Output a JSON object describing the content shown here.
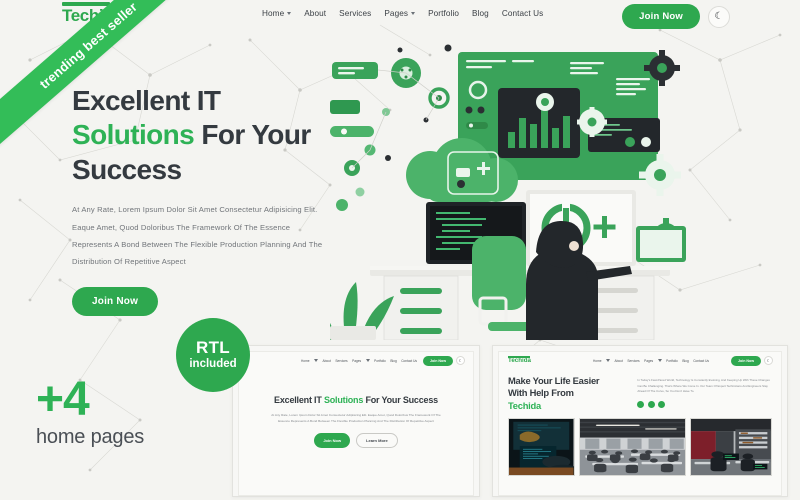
{
  "brand": {
    "name": "Techida",
    "accent_color": "#2ea84f",
    "ribbon_color": "#33bd58",
    "bg_color": "#f4f4f1"
  },
  "ribbon": {
    "text": "trending best seller"
  },
  "navbar": {
    "logo": "Techida",
    "links": [
      {
        "label": "Home",
        "has_dropdown": true
      },
      {
        "label": "About",
        "has_dropdown": false
      },
      {
        "label": "Services",
        "has_dropdown": false
      },
      {
        "label": "Pages",
        "has_dropdown": true
      },
      {
        "label": "Portfolio",
        "has_dropdown": false
      },
      {
        "label": "Blog",
        "has_dropdown": false
      },
      {
        "label": "Contact Us",
        "has_dropdown": false
      }
    ],
    "join_label": "Join Now",
    "theme_toggle_icon": "moon-icon",
    "theme_toggle_glyph": "☾"
  },
  "hero": {
    "title_line1": "Excellent IT",
    "title_accent": "Solutions",
    "title_line2_rest": " For Your",
    "title_line3": "Success",
    "paragraph": "At Any Rate, Lorem Ipsum Dolor Sit Amet Consectetur Adipisicing Elit. Eaque Amet, Quod Doloribus The Framework Of The Essence Represents A Bond Between The Flexible Production Planning And The Distribution Of Repetitive Aspect",
    "cta_label": "Join Now"
  },
  "promo": {
    "count": "+4",
    "count_label": "home pages",
    "rtl_badge_line1": "RTL",
    "rtl_badge_line2": "included"
  },
  "preview_left": {
    "nav_links": [
      "Home",
      "About",
      "Services",
      "Pages",
      "Portfolio",
      "Blog",
      "Contact Us"
    ],
    "join_label": "Join Now",
    "theme_toggle_glyph": "☾",
    "heading_a": "Excellent IT ",
    "heading_accent": "Solutions",
    "heading_b": " For Your Success",
    "paragraph": "At Any Rate, Lorem Ipsum Dolor Sit Amet Consectetur Adipisicing Elit. Eaque Amet, Quod Doloribus The Framework Of The Essence Represents A Bond Between The Flexible Production Planning And The Distribution Of Repetitive Aspect",
    "btn_primary": "Join Now",
    "btn_secondary": "Learn More"
  },
  "preview_right": {
    "logo": "Techida",
    "nav_links": [
      "Home",
      "About",
      "Services",
      "Pages",
      "Portfolio",
      "Blog",
      "Contact Us"
    ],
    "join_label": "Join Now",
    "theme_toggle_glyph": "☾",
    "heading_line1": "Make Your Life Easier",
    "heading_line2": "With Help From",
    "heading_accent": "Techida",
    "paragraph": "In Today's Fast-Paced World, Technology Is Constantly Evolving, And Keeping Up With These Changes Can Be Challenging. That's Where We Come In. Our Team Of Expert Technicians And Engineers Stay Ahead Of The Curve, So You Don't Have To.",
    "dots_count": 3,
    "gallery": [
      {
        "name": "developer-at-terminal"
      },
      {
        "name": "open-plan-office"
      },
      {
        "name": "workstation-night"
      }
    ]
  },
  "illustration": {
    "name": "it-workspace-illustration",
    "description": "Flat illustration of a developer at a desk with monitors, dashboards, gears, cloud and plant"
  }
}
